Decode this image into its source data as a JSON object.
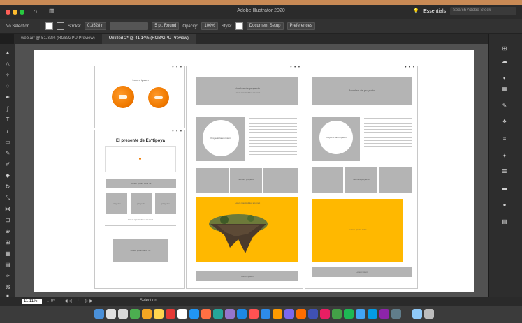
{
  "app": {
    "title": "Adobe Illustrator 2020",
    "workspace": "Essentials",
    "search_placeholder": "Search Adobe Stock"
  },
  "control_bar": {
    "selection": "No Selection",
    "stroke_label": "Stroke:",
    "stroke_value": "0.3528 n",
    "brush": "5 pt. Round",
    "opacity_label": "Opacity:",
    "opacity_value": "100%",
    "style_label": "Style:",
    "document_setup": "Document Setup",
    "preferences": "Preferences"
  },
  "tabs": [
    {
      "label": "web.ai* @ 51.82% (RGB/GPU Preview)"
    },
    {
      "label": "Untitled-2* @ 41.14% (RGB/GPU Preview)"
    }
  ],
  "statusbar": {
    "zoom": "11.11%",
    "page": "1",
    "tool": "Selection"
  },
  "artwork": {
    "small_header": "Lorem ipsum",
    "title": "El presente de Es*tipoya",
    "button_a": "Lorem ipsum dolor sit",
    "small_box_1": "proyecto",
    "small_box_2": "proyecto",
    "small_box_3": "proyecto",
    "footer_text": "Lorem ipsum dolor sit amet",
    "bottom_button": "Lorem ipsum dolor sit",
    "banner_title": "Nombre de proyecto",
    "banner_sub": "Lorem ipsum dolor sit amet",
    "circle_text": "Proyecto lorem ipsum",
    "mid_box": "Nombre proyecto",
    "yellow_caption": "Lorem ipsum dolor sit amet",
    "bottom_bar": "Lorem ipsum",
    "right_banner": "Nombre de proyecto",
    "right_circle_text": "Proyecto lorem ipsum",
    "right_mid": "Nombre proyecto",
    "right_yellow": "Lorem ipsum dolor",
    "right_bottom": "Lorem ipsum"
  },
  "colors": {
    "accent_yellow": "#ffb800",
    "orange": "#f07a00"
  }
}
